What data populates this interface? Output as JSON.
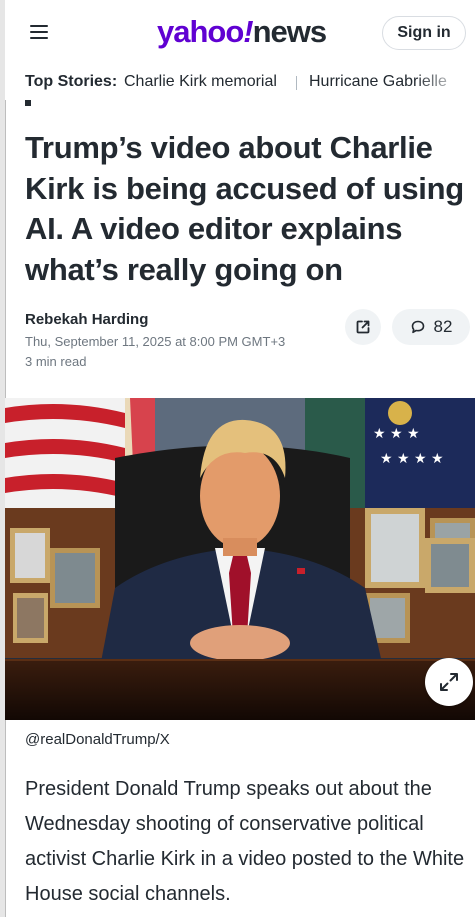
{
  "header": {
    "logo_yahoo": "yahoo",
    "logo_bang": "!",
    "logo_news": "news",
    "signin_label": "Sign in"
  },
  "top_stories": {
    "label": "Top Stories:",
    "items": [
      "Charlie Kirk memorial",
      "Hurricane Gabrielle"
    ]
  },
  "article": {
    "headline": "Trump’s video about Charlie Kirk is being accused of using AI. A video editor explains what’s really going on",
    "author": "Rebekah Harding",
    "date": "Thu, September 11, 2025 at 8:00 PM GMT+3",
    "read_time": "3 min read",
    "comment_count": "82",
    "photo_credit": "@realDonaldTrump/X",
    "body": "President Donald Trump speaks out about the Wednesday shooting of conservative political activist Charlie Kirk in a video posted to the White House social channels."
  },
  "colors": {
    "brand_purple": "#6001d2",
    "text_primary": "#232a31",
    "text_secondary": "#6e7780",
    "button_bg": "#f0f3f5"
  },
  "icons": [
    "menu-icon",
    "share-icon",
    "comment-icon",
    "expand-icon"
  ]
}
